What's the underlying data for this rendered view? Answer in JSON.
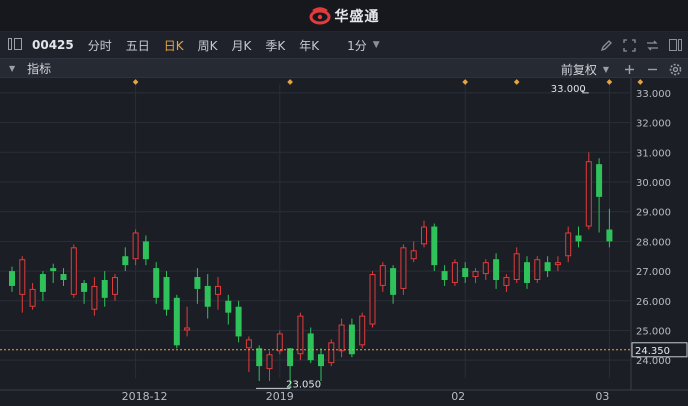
{
  "app": {
    "brand_name": "华盛通"
  },
  "toolbar": {
    "stock_code": "00425",
    "tabs": [
      {
        "label": "分时",
        "active": false
      },
      {
        "label": "五日",
        "active": false
      },
      {
        "label": "日K",
        "active": true
      },
      {
        "label": "周K",
        "active": false
      },
      {
        "label": "月K",
        "active": false
      },
      {
        "label": "季K",
        "active": false
      },
      {
        "label": "年K",
        "active": false
      }
    ],
    "period_select": "1分"
  },
  "indicator_bar": {
    "label": "指标",
    "adjust_select": "前复权"
  },
  "colors": {
    "up": "#e23b3b",
    "down": "#2fc25b",
    "accent": "#e8a33c",
    "background": "#1b1e25"
  },
  "chart_data": {
    "type": "candlestick",
    "ylim": [
      23.4,
      33.3
    ],
    "y_ticks": [
      "33.000",
      "32.000",
      "31.000",
      "30.000",
      "29.000",
      "28.000",
      "27.000",
      "26.000",
      "25.000",
      "24.000"
    ],
    "x_labels": [
      {
        "label": "2018-12",
        "index": 12
      },
      {
        "label": "2019",
        "index": 26
      },
      {
        "label": "02",
        "index": 44
      },
      {
        "label": "03",
        "index": 58
      }
    ],
    "event_marker_indices": [
      12,
      27,
      44,
      49,
      58,
      61,
      67
    ],
    "annotations": [
      {
        "text": "33.000",
        "kind": "high",
        "value": 33.0,
        "index": 56
      },
      {
        "text": "23.050",
        "kind": "low",
        "value": 23.05,
        "index": 27
      }
    ],
    "current_price": "24.350",
    "candles": [
      [
        27.0,
        26.5,
        27.15,
        26.3
      ],
      [
        26.2,
        27.4,
        27.5,
        25.6
      ],
      [
        25.8,
        26.4,
        26.6,
        25.7
      ],
      [
        26.9,
        26.3,
        27.0,
        26.0
      ],
      [
        27.1,
        27.0,
        27.25,
        26.6
      ],
      [
        26.9,
        26.7,
        27.1,
        26.5
      ],
      [
        26.2,
        27.8,
        27.9,
        26.1
      ],
      [
        26.6,
        26.3,
        26.7,
        25.9
      ],
      [
        25.7,
        26.5,
        26.8,
        25.5
      ],
      [
        26.7,
        26.1,
        27.0,
        25.8
      ],
      [
        26.2,
        26.8,
        26.9,
        26.0
      ],
      [
        27.5,
        27.2,
        27.8,
        27.0
      ],
      [
        27.4,
        28.3,
        28.4,
        27.2
      ],
      [
        28.0,
        27.4,
        28.2,
        27.2
      ],
      [
        27.1,
        26.1,
        27.3,
        25.9
      ],
      [
        26.8,
        25.7,
        27.0,
        25.5
      ],
      [
        26.1,
        24.5,
        26.2,
        24.4
      ],
      [
        25.0,
        25.1,
        25.8,
        24.8
      ],
      [
        26.8,
        26.4,
        27.1,
        25.9
      ],
      [
        26.5,
        25.8,
        26.9,
        25.4
      ],
      [
        26.2,
        26.5,
        26.8,
        25.7
      ],
      [
        26.0,
        25.6,
        26.2,
        25.2
      ],
      [
        25.8,
        24.8,
        26.0,
        24.6
      ],
      [
        24.4,
        24.7,
        24.8,
        23.6
      ],
      [
        24.4,
        23.8,
        24.5,
        23.3
      ],
      [
        23.7,
        24.2,
        24.3,
        23.3
      ],
      [
        24.3,
        24.9,
        25.0,
        24.2
      ],
      [
        24.4,
        23.8,
        24.4,
        23.05
      ],
      [
        24.2,
        25.5,
        25.6,
        24.0
      ],
      [
        24.9,
        24.0,
        25.1,
        23.9
      ],
      [
        24.2,
        23.8,
        24.4,
        23.3
      ],
      [
        23.9,
        24.6,
        24.7,
        23.8
      ],
      [
        24.3,
        25.2,
        25.4,
        24.1
      ],
      [
        25.2,
        24.2,
        25.4,
        24.1
      ],
      [
        24.5,
        25.5,
        25.6,
        24.4
      ],
      [
        25.2,
        26.9,
        27.0,
        25.1
      ],
      [
        26.5,
        27.2,
        27.3,
        26.3
      ],
      [
        27.1,
        26.2,
        27.2,
        25.9
      ],
      [
        26.4,
        27.8,
        27.9,
        26.2
      ],
      [
        27.4,
        27.7,
        28.0,
        27.3
      ],
      [
        27.9,
        28.5,
        28.7,
        27.8
      ],
      [
        28.5,
        27.2,
        28.6,
        27.0
      ],
      [
        27.0,
        26.7,
        27.2,
        26.5
      ],
      [
        26.6,
        27.3,
        27.4,
        26.5
      ],
      [
        27.1,
        26.8,
        27.3,
        26.6
      ],
      [
        26.8,
        27.0,
        27.1,
        26.6
      ],
      [
        26.9,
        27.3,
        27.4,
        26.7
      ],
      [
        27.4,
        26.7,
        27.6,
        26.4
      ],
      [
        26.5,
        26.8,
        26.9,
        26.3
      ],
      [
        26.7,
        27.6,
        27.8,
        26.6
      ],
      [
        27.3,
        26.6,
        27.5,
        26.4
      ],
      [
        26.7,
        27.4,
        27.5,
        26.6
      ],
      [
        27.3,
        27.0,
        27.5,
        26.8
      ],
      [
        27.2,
        27.3,
        27.5,
        27.0
      ],
      [
        27.5,
        28.3,
        28.5,
        27.3
      ],
      [
        28.2,
        28.0,
        28.5,
        27.8
      ],
      [
        28.5,
        30.7,
        31.0,
        28.4
      ],
      [
        30.6,
        29.5,
        30.8,
        28.3
      ],
      [
        28.4,
        28.0,
        29.1,
        27.8
      ]
    ]
  }
}
